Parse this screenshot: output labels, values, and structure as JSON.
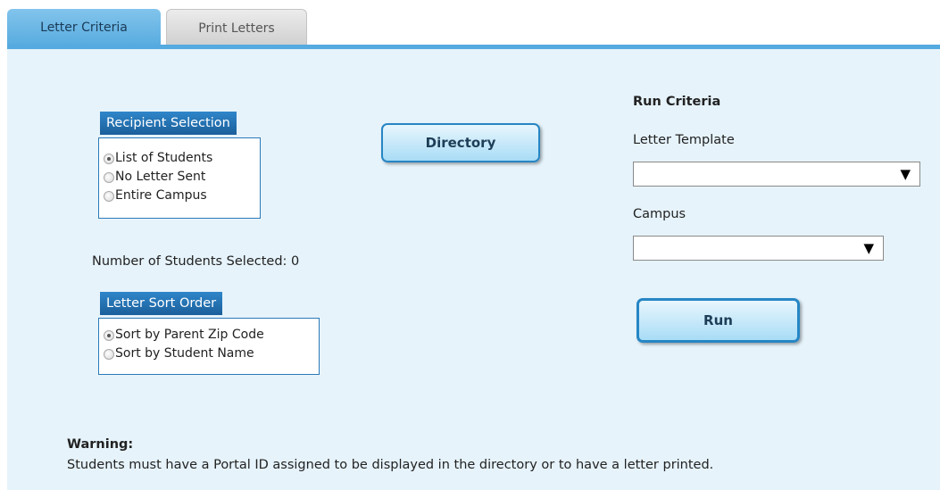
{
  "tabs": [
    {
      "label": "Letter Criteria",
      "active": true
    },
    {
      "label": "Print Letters",
      "active": false
    }
  ],
  "recipient_selection": {
    "title": "Recipient Selection",
    "options": [
      "List of Students",
      "No Letter Sent",
      "Entire Campus"
    ],
    "selected": "List of Students"
  },
  "directory_button": "Directory",
  "students_selected": "Number of Students Selected: 0",
  "sort_order": {
    "title": "Letter Sort Order",
    "options": [
      "Sort by Parent Zip Code",
      "Sort by Student Name"
    ],
    "selected": "Sort by Parent Zip Code"
  },
  "run_criteria": {
    "heading": "Run Criteria",
    "template_label": "Letter Template",
    "template_value": "",
    "campus_label": "Campus",
    "campus_value": "",
    "arrow_glyph": "▼",
    "run_button": "Run"
  },
  "warning": {
    "heading": "Warning:",
    "text": "Students must have a Portal ID assigned to be displayed in the directory or to have a letter printed."
  },
  "colors": {
    "tab_active": "#55aadf",
    "panel_bg": "#e6f3fb",
    "box_title": "#1b5f9b",
    "button_border": "#2686c4"
  }
}
